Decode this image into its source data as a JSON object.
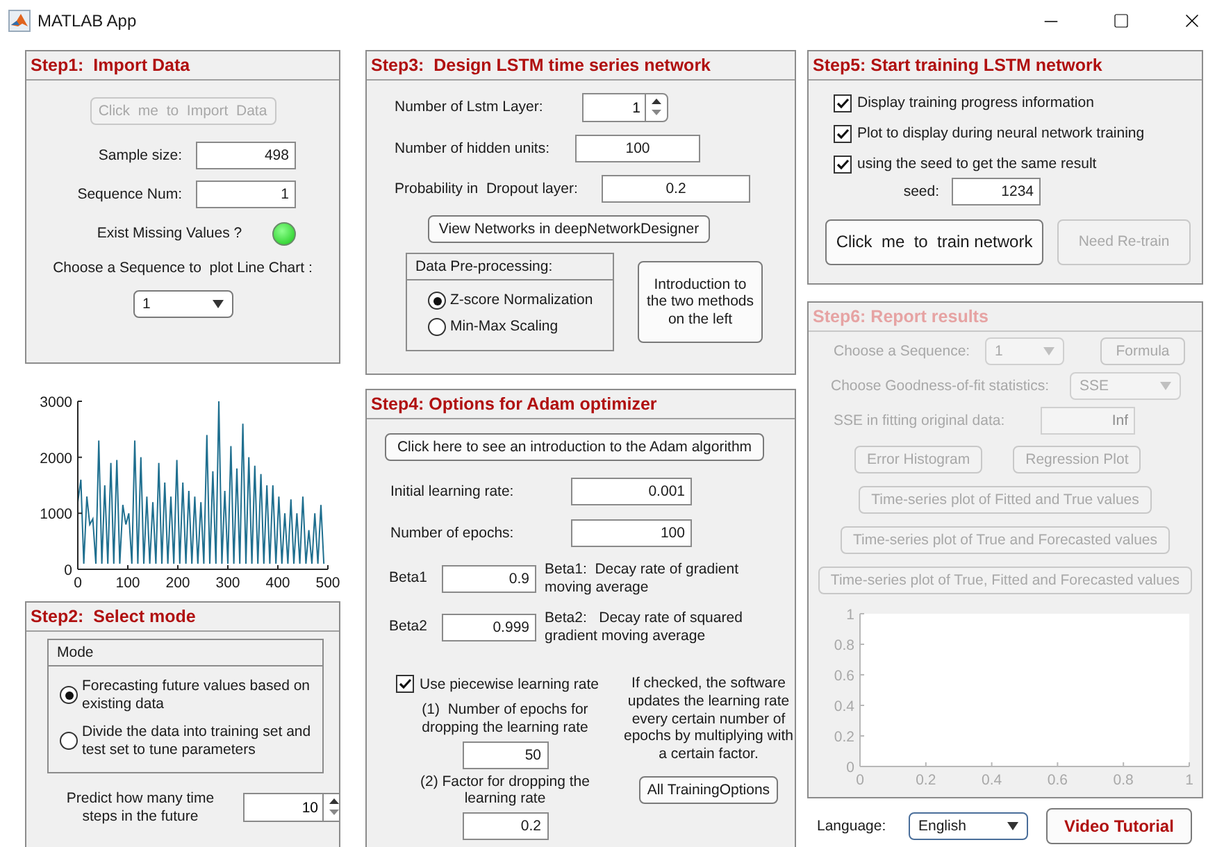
{
  "window": {
    "title": "MATLAB App"
  },
  "step1": {
    "title": "Step1:  Import Data",
    "import_button": {
      "label": "Click  me  to  Import  Data",
      "disabled": true
    },
    "fields": [
      {
        "label": "Sample size:",
        "value": "498"
      },
      {
        "label": "Sequence Num:",
        "value": "1"
      }
    ],
    "missing": {
      "label": "Exist Missing Values ?",
      "on": true
    },
    "sequence_label": "Choose a Sequence to  plot Line Chart :",
    "sequence_value": "1"
  },
  "data_chart": {
    "chart_data": {
      "type": "line",
      "xlim": [
        0,
        500
      ],
      "ylim": [
        0,
        3000
      ],
      "xticks": [
        0,
        100,
        200,
        300,
        400,
        500
      ],
      "yticks": [
        0,
        1000,
        2000,
        3000
      ],
      "x": [
        0,
        6,
        12,
        18,
        24,
        30,
        36,
        42,
        48,
        54,
        60,
        66,
        72,
        78,
        84,
        90,
        96,
        102,
        108,
        114,
        120,
        126,
        132,
        138,
        144,
        150,
        156,
        162,
        168,
        174,
        180,
        186,
        192,
        198,
        204,
        210,
        216,
        222,
        228,
        234,
        240,
        246,
        252,
        258,
        264,
        270,
        276,
        282,
        288,
        294,
        300,
        306,
        312,
        318,
        324,
        330,
        336,
        342,
        348,
        354,
        360,
        366,
        372,
        378,
        384,
        390,
        396,
        402,
        408,
        414,
        420,
        426,
        432,
        438,
        444,
        450,
        456,
        462,
        468,
        474,
        480,
        486,
        492
      ],
      "values": [
        1200,
        1600,
        100,
        1300,
        800,
        900,
        100,
        2300,
        100,
        1500,
        100,
        1900,
        100,
        1950,
        100,
        1150,
        800,
        1000,
        100,
        2300,
        100,
        2000,
        100,
        1300,
        100,
        1200,
        100,
        1900,
        100,
        1550,
        100,
        1300,
        100,
        1950,
        100,
        1550,
        100,
        1400,
        100,
        1300,
        100,
        1200,
        100,
        2400,
        100,
        1750,
        100,
        3000,
        100,
        1400,
        100,
        2200,
        100,
        1800,
        100,
        2600,
        100,
        2000,
        100,
        1850,
        100,
        1700,
        100,
        1500,
        100,
        1500,
        100,
        1300,
        100,
        1000,
        100,
        1250,
        100,
        1000,
        100,
        1300,
        100,
        700,
        100,
        1000,
        100,
        1150,
        100
      ]
    }
  },
  "step2": {
    "title": "Step2:  Select mode",
    "mode_group": {
      "title": "Mode",
      "options": [
        {
          "label": "Forecasting future values based on existing data",
          "selected": true
        },
        {
          "label": "Divide the data into training set and test set to tune parameters",
          "selected": false
        }
      ]
    },
    "predict": {
      "label": "Predict how many time steps in the future",
      "value": "10"
    }
  },
  "step3": {
    "title": "Step3:  Design LSTM time series network",
    "fields": [
      {
        "kind": "spinner",
        "label": "Number of Lstm Layer:",
        "value": "1"
      },
      {
        "kind": "text",
        "label": "Number of hidden units:",
        "value": "100"
      },
      {
        "kind": "text",
        "label": "Probability in  Dropout layer:",
        "value": "0.2"
      }
    ],
    "view_button": "View Networks in deepNetworkDesigner",
    "preprocessing": {
      "title": "Data Pre-processing:",
      "options": [
        {
          "label": "Z-score Normalization",
          "selected": true
        },
        {
          "label": "Min-Max Scaling",
          "selected": false
        }
      ]
    },
    "intro_button": "Introduction to the two methods on the left"
  },
  "step4": {
    "title": "Step4: Options for Adam optimizer",
    "intro_button": "Click here to see an introduction to the Adam algorithm",
    "fields": [
      {
        "label": "Initial learning rate:",
        "value": "0.001"
      },
      {
        "label": "Number of epochs:",
        "value": "100"
      }
    ],
    "betas": [
      {
        "label": "Beta1",
        "value": "0.9",
        "note": "Beta1:  Decay rate of gradient moving average"
      },
      {
        "label": "Beta2",
        "value": "0.999",
        "note": "Beta2:   Decay rate of squared gradient moving average"
      }
    ],
    "piecewise": {
      "label": "Use piecewise learning rate",
      "checked": true
    },
    "drop_epochs": {
      "label": "(1)  Number of epochs for dropping the learning rate",
      "value": "50"
    },
    "drop_factor": {
      "label": "(2) Factor for dropping the learning rate",
      "value": "0.2"
    },
    "note": "If checked, the software updates the learning rate every certain number of epochs by multiplying with a certain factor.",
    "options_button": "All TrainingOptions"
  },
  "step5": {
    "title": "Step5: Start training LSTM network",
    "checks": [
      {
        "label": "Display training progress information",
        "checked": true
      },
      {
        "label": "Plot to display during neural network training",
        "checked": true
      },
      {
        "label": "using the seed to get the same result",
        "checked": true
      }
    ],
    "seed": {
      "label": "seed:",
      "value": "1234"
    },
    "train_button": {
      "label": "Click  me  to  train network",
      "disabled": false
    },
    "retrain_button": {
      "label": "Need Re-train",
      "disabled": true
    }
  },
  "step6": {
    "title": "Step6: Report results",
    "disabled": true,
    "sequence": {
      "label": "Choose a Sequence:",
      "value": "1"
    },
    "formula_button": "Formula",
    "gof": {
      "label": "Choose Goodness-of-fit statistics:",
      "value": "SSE"
    },
    "sse": {
      "label": "SSE in fitting original data:",
      "value": "Inf"
    },
    "buttons": [
      "Error Histogram",
      "Regression Plot",
      "Time-series plot of Fitted and True values",
      "Time-series plot of True and Forecasted values",
      "Time-series plot of True, Fitted and Forecasted values"
    ],
    "chart_data": {
      "type": "line",
      "xlim": [
        0,
        1
      ],
      "ylim": [
        0,
        1
      ],
      "xticks": [
        0,
        0.2,
        0.4,
        0.6,
        0.8,
        1
      ],
      "yticks": [
        0,
        0.2,
        0.4,
        0.6,
        0.8,
        1
      ]
    }
  },
  "footer": {
    "language_label": "Language:",
    "language": "English",
    "video_button": "Video Tutorial"
  }
}
